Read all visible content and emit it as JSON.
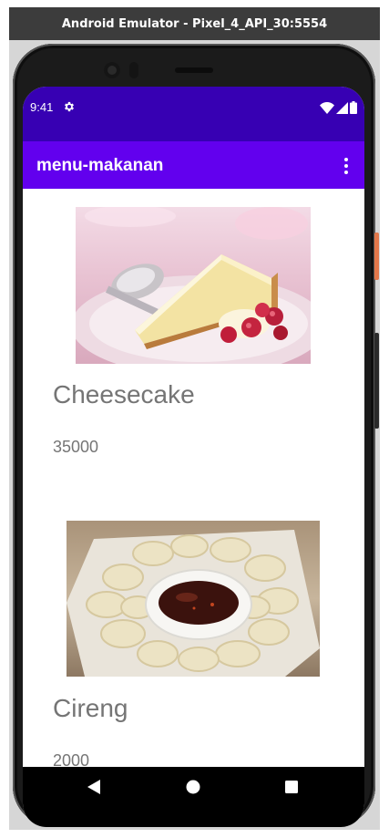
{
  "window": {
    "title": "Android Emulator - Pixel_4_API_30:5554"
  },
  "status_bar": {
    "time": "9:41",
    "icons": [
      "settings-icon",
      "wifi-icon",
      "signal-icon",
      "battery-icon"
    ],
    "color": "#3700b3"
  },
  "app_bar": {
    "title": "menu-makanan",
    "menu_icon": "more-vert-icon",
    "color": "#6200ee"
  },
  "menu": {
    "items": [
      {
        "name": "Cheesecake",
        "price": "35000",
        "image": "cheesecake-photo"
      },
      {
        "name": "Cireng",
        "price": "2000",
        "image": "cireng-photo"
      }
    ]
  },
  "nav_bar": {
    "buttons": [
      "back-icon",
      "home-icon",
      "recents-icon"
    ]
  }
}
